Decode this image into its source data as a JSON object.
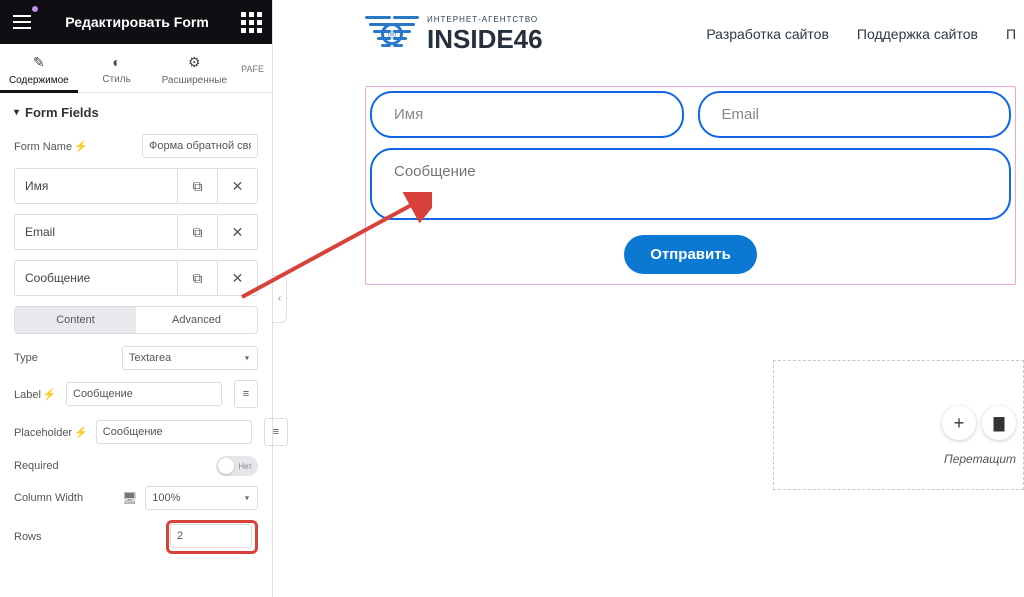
{
  "header": {
    "title": "Редактировать Form"
  },
  "tabs": {
    "content": "Содержимое",
    "style": "Стиль",
    "advanced": "Расширенные",
    "pafe": "PAFE"
  },
  "section_title": "Form Fields",
  "form_name": {
    "label": "Form Name",
    "value": "Форма обратной связи"
  },
  "fields": [
    {
      "name": "Имя"
    },
    {
      "name": "Email"
    },
    {
      "name": "Сообщение"
    }
  ],
  "subtabs": {
    "content": "Content",
    "advanced": "Advanced"
  },
  "props": {
    "type_label": "Type",
    "type_value": "Textarea",
    "label_label": "Label",
    "label_value": "Сообщение",
    "placeholder_label": "Placeholder",
    "placeholder_value": "Сообщение",
    "required_label": "Required",
    "required_off": "Нет",
    "colwidth_label": "Column Width",
    "colwidth_value": "100%",
    "rows_label": "Rows",
    "rows_value": "2"
  },
  "site": {
    "logo_sub": "ИНТЕРНЕТ-АГЕНТСТВО",
    "logo_main": "INSIDE46",
    "menu": [
      "Разработка сайтов",
      "Поддержка сайтов",
      "П"
    ]
  },
  "form": {
    "name_ph": "Имя",
    "email_ph": "Email",
    "msg_ph": "Сообщение",
    "submit": "Отправить"
  },
  "drop": {
    "drag": "Перетащит"
  }
}
